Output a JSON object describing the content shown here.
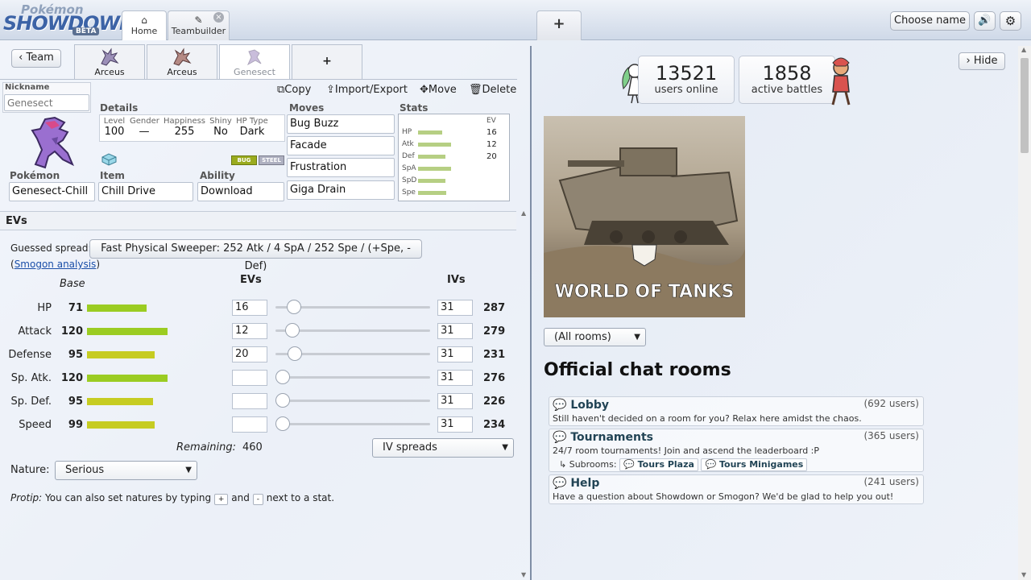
{
  "header": {
    "logo_top": "Pokémon",
    "logo_main": "SHOWDOWN!",
    "logo_badge": "BETA",
    "tabs": [
      {
        "label": "Home"
      },
      {
        "label": "Teambuilder"
      }
    ],
    "new_tab_label": "+",
    "choose_name": "Choose name"
  },
  "teambuilder": {
    "team_button": "Team",
    "pokemon_tabs": [
      {
        "label": "Arceus"
      },
      {
        "label": "Arceus"
      },
      {
        "label": "Genesect"
      }
    ],
    "add_tab": "+",
    "actions": {
      "copy": "Copy",
      "import_export": "Import/Export",
      "move": "Move",
      "delete": "Delete"
    },
    "nickname_label": "Nickname",
    "nickname_placeholder": "Genesect",
    "details_label": "Details",
    "details": {
      "level_h": "Level",
      "level": "100",
      "gender_h": "Gender",
      "gender": "—",
      "happiness_h": "Happiness",
      "happiness": "255",
      "shiny_h": "Shiny",
      "shiny": "No",
      "hptype_h": "HP Type",
      "hptype": "Dark"
    },
    "types": [
      "BUG",
      "STEEL"
    ],
    "pokemon_label": "Pokémon",
    "pokemon": "Genesect-Chill",
    "item_label": "Item",
    "item": "Chill Drive",
    "ability_label": "Ability",
    "ability": "Download",
    "moves_label": "Moves",
    "moves": [
      "Bug Buzz",
      "Facade",
      "Frustration",
      "Giga Drain"
    ],
    "stats_label": "Stats",
    "stats_mini": {
      "ev_header": "EV",
      "rows": [
        {
          "name": "HP",
          "bar": 0.4,
          "ev": "16"
        },
        {
          "name": "Atk",
          "bar": 0.55,
          "ev": "12"
        },
        {
          "name": "Def",
          "bar": 0.45,
          "ev": "20"
        },
        {
          "name": "SpA",
          "bar": 0.55,
          "ev": ""
        },
        {
          "name": "SpD",
          "bar": 0.45,
          "ev": ""
        },
        {
          "name": "Spe",
          "bar": 0.47,
          "ev": ""
        }
      ]
    }
  },
  "evs": {
    "section_title": "EVs",
    "guessed_label": "Guessed spread:",
    "guessed_value": "Fast Physical Sweeper: 252 Atk / 4 SpA / 252 Spe / (+Spe, -Def)",
    "smogon_link": "Smogon analysis",
    "base_header": "Base",
    "evs_header": "EVs",
    "ivs_header": "IVs",
    "rows": [
      {
        "name": "HP",
        "base": "71",
        "base_fill": 0.36,
        "color": "#9bcc22",
        "ev": "16",
        "ev_fill": 0.078,
        "iv": "31",
        "total": "287"
      },
      {
        "name": "Attack",
        "base": "120",
        "base_fill": 0.49,
        "color": "#9bcc22",
        "ev": "12",
        "ev_fill": 0.067,
        "iv": "31",
        "total": "279"
      },
      {
        "name": "Defense",
        "base": "95",
        "base_fill": 0.41,
        "color": "#c6cc22",
        "ev": "20",
        "ev_fill": 0.089,
        "iv": "31",
        "total": "231"
      },
      {
        "name": "Sp. Atk.",
        "base": "120",
        "base_fill": 0.49,
        "color": "#9bcc22",
        "ev": "",
        "ev_fill": 0,
        "iv": "31",
        "total": "276"
      },
      {
        "name": "Sp. Def.",
        "base": "95",
        "base_fill": 0.4,
        "color": "#c6cc22",
        "ev": "",
        "ev_fill": 0,
        "iv": "31",
        "total": "226"
      },
      {
        "name": "Speed",
        "base": "99",
        "base_fill": 0.41,
        "color": "#c6cc22",
        "ev": "",
        "ev_fill": 0,
        "iv": "31",
        "total": "234"
      }
    ],
    "remaining_label": "Remaining:",
    "remaining_value": "460",
    "iv_spreads": "IV spreads",
    "nature_label": "Nature:",
    "nature_value": "Serious",
    "protip_prefix": "Protip:",
    "protip_a": "You can also set natures by typing",
    "protip_plus": "+",
    "protip_and": "and",
    "protip_minus": "-",
    "protip_b": "next to a stat."
  },
  "right": {
    "hide": "Hide",
    "users_online_count": "13521",
    "users_online_label": "users online",
    "active_battles_count": "1858",
    "active_battles_label": "active battles",
    "ad_brand": "WORLD OF TANKS",
    "rooms_filter": "(All rooms)",
    "official_title": "Official chat rooms",
    "rooms": [
      {
        "name": "Lobby",
        "users": "(692 users)",
        "desc": "Still haven't decided on a room for you? Relax here amidst the chaos."
      },
      {
        "name": "Tournaments",
        "users": "(365 users)",
        "desc": "24/7 room tournaments! Join and ascend the leaderboard :P"
      },
      {
        "name": "Help",
        "users": "(241 users)",
        "desc": "Have a question about Showdown or Smogon? We'd be glad to help you out!"
      }
    ],
    "subrooms_label": "Subrooms:",
    "subrooms": [
      "Tours Plaza",
      "Tours Minigames"
    ]
  }
}
